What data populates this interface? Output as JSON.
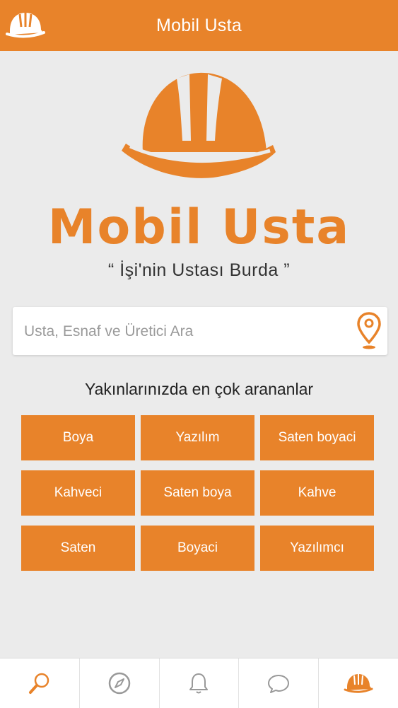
{
  "colors": {
    "accent": "#e8832a",
    "background": "#ebebeb",
    "tab_icon": "#999999"
  },
  "header": {
    "title": "Mobil Usta",
    "logo_icon": "hardhat-icon"
  },
  "brand": {
    "name": "Mobil Usta",
    "slogan": "“ İşi'nin Ustası Burda ”"
  },
  "search": {
    "placeholder": "Usta, Esnaf ve Üretici Ara",
    "value": "",
    "icon": "location-pin-icon"
  },
  "popular": {
    "title": "Yakınlarınızda en çok arananlar",
    "items": [
      "Boya",
      "Yazılım",
      "Saten boyaci",
      "Kahveci",
      "Saten boya",
      "Kahve",
      "Saten",
      "Boyaci",
      "Yazılımcı"
    ]
  },
  "bottom_nav": {
    "tabs": [
      {
        "icon": "search-icon",
        "active": true
      },
      {
        "icon": "compass-icon",
        "active": false
      },
      {
        "icon": "bell-icon",
        "active": false
      },
      {
        "icon": "chat-icon",
        "active": false
      },
      {
        "icon": "hardhat-icon",
        "active": false
      }
    ]
  }
}
